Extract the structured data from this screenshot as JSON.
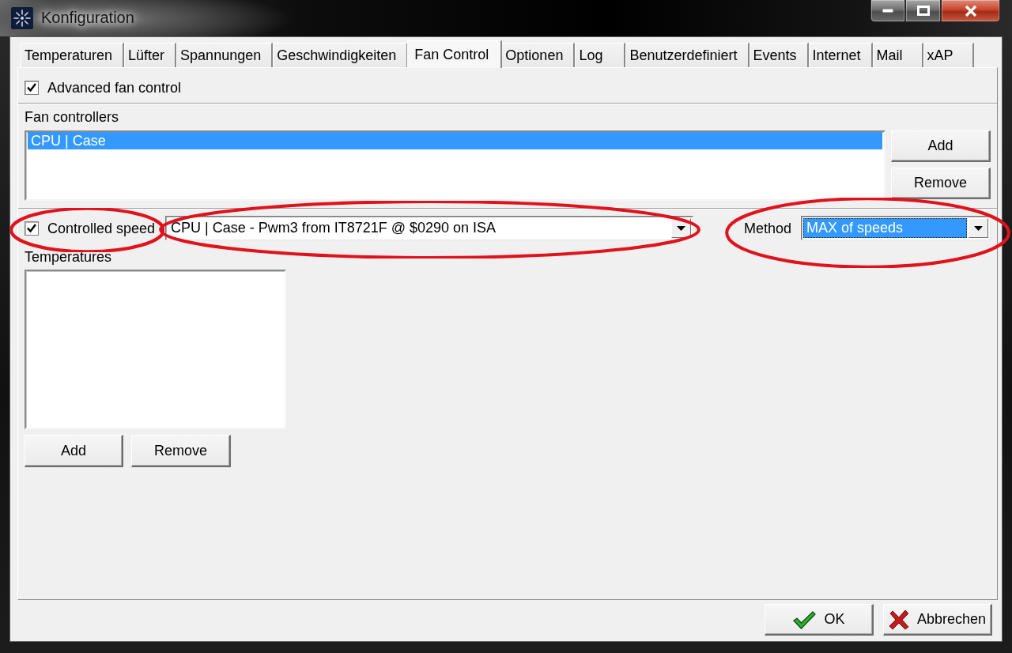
{
  "window": {
    "title": "Konfiguration"
  },
  "tabs": [
    {
      "label": "Temperaturen",
      "selected": false
    },
    {
      "label": "Lüfter",
      "selected": false
    },
    {
      "label": "Spannungen",
      "selected": false
    },
    {
      "label": "Geschwindigkeiten",
      "selected": false
    },
    {
      "label": "Fan Control",
      "selected": true
    },
    {
      "label": "Optionen",
      "selected": false
    },
    {
      "label": "Log",
      "selected": false
    },
    {
      "label": "Benutzerdefiniert",
      "selected": false
    },
    {
      "label": "Events",
      "selected": false
    },
    {
      "label": "Internet",
      "selected": false
    },
    {
      "label": "Mail",
      "selected": false
    },
    {
      "label": "xAP",
      "selected": false
    }
  ],
  "advanced_fan_control": {
    "label": "Advanced fan control",
    "checked": true
  },
  "fan_controllers": {
    "label": "Fan controllers",
    "items": [
      {
        "label": "CPU | Case",
        "selected": true
      }
    ],
    "buttons": [
      "Add",
      "Remove"
    ]
  },
  "controlled_speed": {
    "label": "Controlled speed",
    "checked": true,
    "circled": true
  },
  "fan_selector": {
    "value": "CPU | Case - Pwm3 from IT8721F @ $0290 on ISA",
    "focused": false,
    "circled": true
  },
  "method": {
    "label": "Method",
    "value": "MAX of speeds",
    "focused": true,
    "circled": true
  },
  "temperatures": {
    "label": "Temperatures",
    "buttons": [
      "Add",
      "Remove"
    ]
  },
  "dialog_buttons": [
    {
      "label": "OK",
      "kind": "ok"
    },
    {
      "label": "Abbrechen",
      "kind": "cancel"
    }
  ]
}
